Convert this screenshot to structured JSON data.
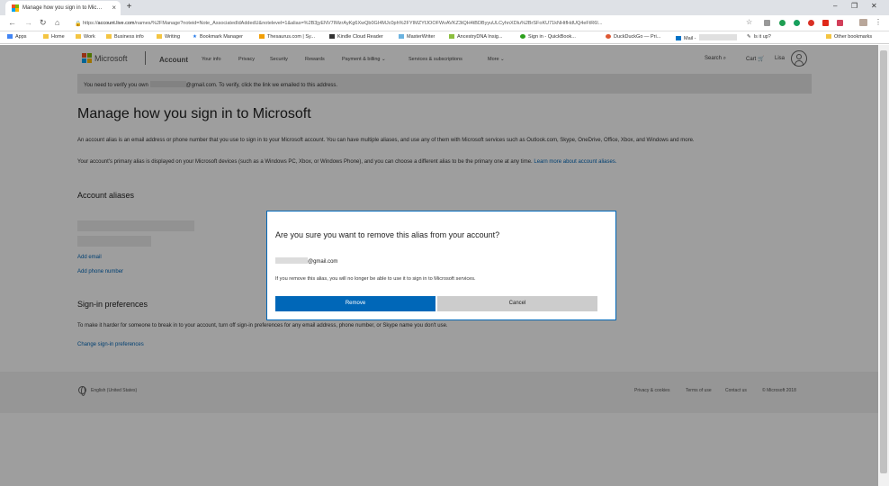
{
  "browser": {
    "tab_title": "Manage how you sign in to Mic…",
    "tab_close": "×",
    "new_tab": "+",
    "window_controls": [
      "–",
      "❐",
      "✕"
    ],
    "url_prefix": "https://",
    "url_host": "account.live.com",
    "url_rest": "/names/%2FManage?noteid=Note_AssociatedIdAddedU&notelevel=1&alias=%2B3jyENV7IMzrAyKg6XwQb0GI4MJc0ph%2FYIMZYfJOOFWvAVKZ3tQH4tBDByyuULCyhnXDlu%2BrSFoKU71kNHtfHdUQ4eFtR6I...",
    "bookmarks": [
      "Apps",
      "Home",
      "Work",
      "Business info",
      "Writing",
      "Bookmark Manager",
      "Thesaurus.com | Sy...",
      "Kindle Cloud Reader",
      "MasterWriter",
      "AncestryDNA Insig...",
      "Sign in - QuickBook...",
      "DuckDuckGo — Pri...",
      "Mail -",
      "Is it up?",
      "Other bookmarks"
    ]
  },
  "header": {
    "brand": "Microsoft",
    "section": "Account",
    "nav": [
      "Your info",
      "Privacy",
      "Security",
      "Rewards",
      "Payment & billing ⌄",
      "Services & subscriptions",
      "More ⌄"
    ],
    "search": "Search ⌕",
    "cart": "Cart 🛒",
    "user": "Lisa"
  },
  "notice": {
    "before": "You need to verify you own",
    "after": "@gmail.com. To verify, click the link we emailed to this address."
  },
  "main": {
    "title": "Manage how you sign in to Microsoft",
    "intro": "An account alias is an email address or phone number that you use to sign in to your Microsoft account. You can have multiple aliases, and use any of them with Microsoft services such as Outlook.com, Skype, OneDrive, Office, Xbox, and Windows and more.",
    "primary_text": "Your account's primary alias is displayed on your Microsoft devices (such as a Windows PC, Xbox, or Windows Phone), and you can choose a different alias to be the primary one at any time.",
    "primary_link": "Learn more about account aliases.",
    "aliases_heading": "Account aliases",
    "add_email": "Add email",
    "add_phone": "Add phone number",
    "prefs_heading": "Sign-in preferences",
    "prefs_text": "To make it harder for someone to break in to your account, turn off sign-in preferences for any email address, phone number, or Skype name you don't use.",
    "prefs_link": "Change sign-in preferences"
  },
  "footer": {
    "language": "English (United States)",
    "links": [
      "Privacy & cookies",
      "Terms of use",
      "Contact us",
      "© Microsoft 2018"
    ]
  },
  "dialog": {
    "title": "Are you sure you want to remove this alias from your account?",
    "email_suffix": "@gmail.com",
    "message": "If you remove this alias, you will no longer be able to use it to sign in to Microsoft services.",
    "remove_label": "Remove",
    "cancel_label": "Cancel"
  },
  "colors": {
    "accent": "#0067b8",
    "ms_red": "#f25022",
    "ms_green": "#7fba00",
    "ms_blue": "#00a4ef",
    "ms_yellow": "#ffb900"
  }
}
